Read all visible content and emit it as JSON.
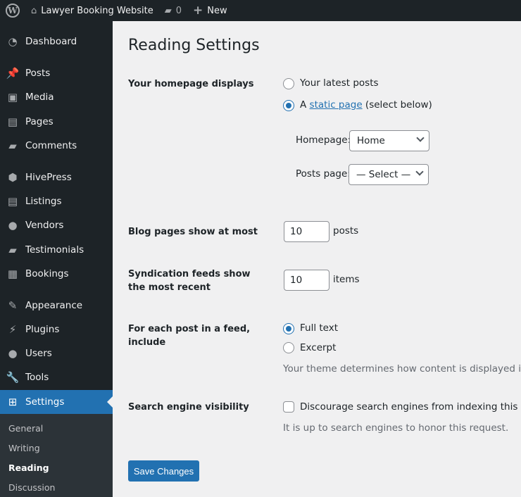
{
  "topbar": {
    "site_name": "Lawyer Booking Website",
    "comments_count": "0",
    "new_label": "New"
  },
  "sidebar": {
    "items": [
      {
        "label": "Dashboard",
        "icon": "dashboard-icon",
        "glyph": "◔"
      },
      {
        "label": "Posts",
        "icon": "pin-icon",
        "glyph": "📌"
      },
      {
        "label": "Media",
        "icon": "media-icon",
        "glyph": "▣"
      },
      {
        "label": "Pages",
        "icon": "pages-icon",
        "glyph": "▤"
      },
      {
        "label": "Comments",
        "icon": "comment-icon",
        "glyph": "▰"
      },
      {
        "label": "HivePress",
        "icon": "hivepress-icon",
        "glyph": "⬢"
      },
      {
        "label": "Listings",
        "icon": "listings-icon",
        "glyph": "▤"
      },
      {
        "label": "Vendors",
        "icon": "user-icon",
        "glyph": "●"
      },
      {
        "label": "Testimonials",
        "icon": "testimonial-icon",
        "glyph": "▰"
      },
      {
        "label": "Bookings",
        "icon": "calendar-icon",
        "glyph": "▦"
      },
      {
        "label": "Appearance",
        "icon": "brush-icon",
        "glyph": "✎"
      },
      {
        "label": "Plugins",
        "icon": "plugin-icon",
        "glyph": "⚡"
      },
      {
        "label": "Users",
        "icon": "users-icon",
        "glyph": "●"
      },
      {
        "label": "Tools",
        "icon": "wrench-icon",
        "glyph": "🔧"
      },
      {
        "label": "Settings",
        "icon": "settings-icon",
        "glyph": "⊞"
      }
    ],
    "submenu": [
      "General",
      "Writing",
      "Reading",
      "Discussion"
    ]
  },
  "page": {
    "title": "Reading Settings",
    "homepage_displays": {
      "label": "Your homepage displays",
      "opt_latest": "Your latest posts",
      "opt_static_prefix": "A",
      "opt_static_link": "static page",
      "opt_static_suffix": "(select below)",
      "selected": "static",
      "homepage_label": "Homepage:",
      "homepage_value": "Home",
      "posts_page_label": "Posts page:",
      "posts_page_value": "— Select —"
    },
    "blog_pages": {
      "label": "Blog pages show at most",
      "value": "10",
      "unit": "posts"
    },
    "syndication": {
      "label": "Syndication feeds show the most recent",
      "value": "10",
      "unit": "items"
    },
    "feed_include": {
      "label": "For each post in a feed, include",
      "opt_full": "Full text",
      "opt_excerpt": "Excerpt",
      "selected": "full",
      "desc": "Your theme determines how content is displayed in bro"
    },
    "search_visibility": {
      "label": "Search engine visibility",
      "checkbox": "Discourage search engines from indexing this site",
      "checked": false,
      "desc": "It is up to search engines to honor this request."
    },
    "save_label": "Save Changes"
  },
  "colors": {
    "accent": "#2271b1",
    "sidebar": "#1d2327"
  }
}
